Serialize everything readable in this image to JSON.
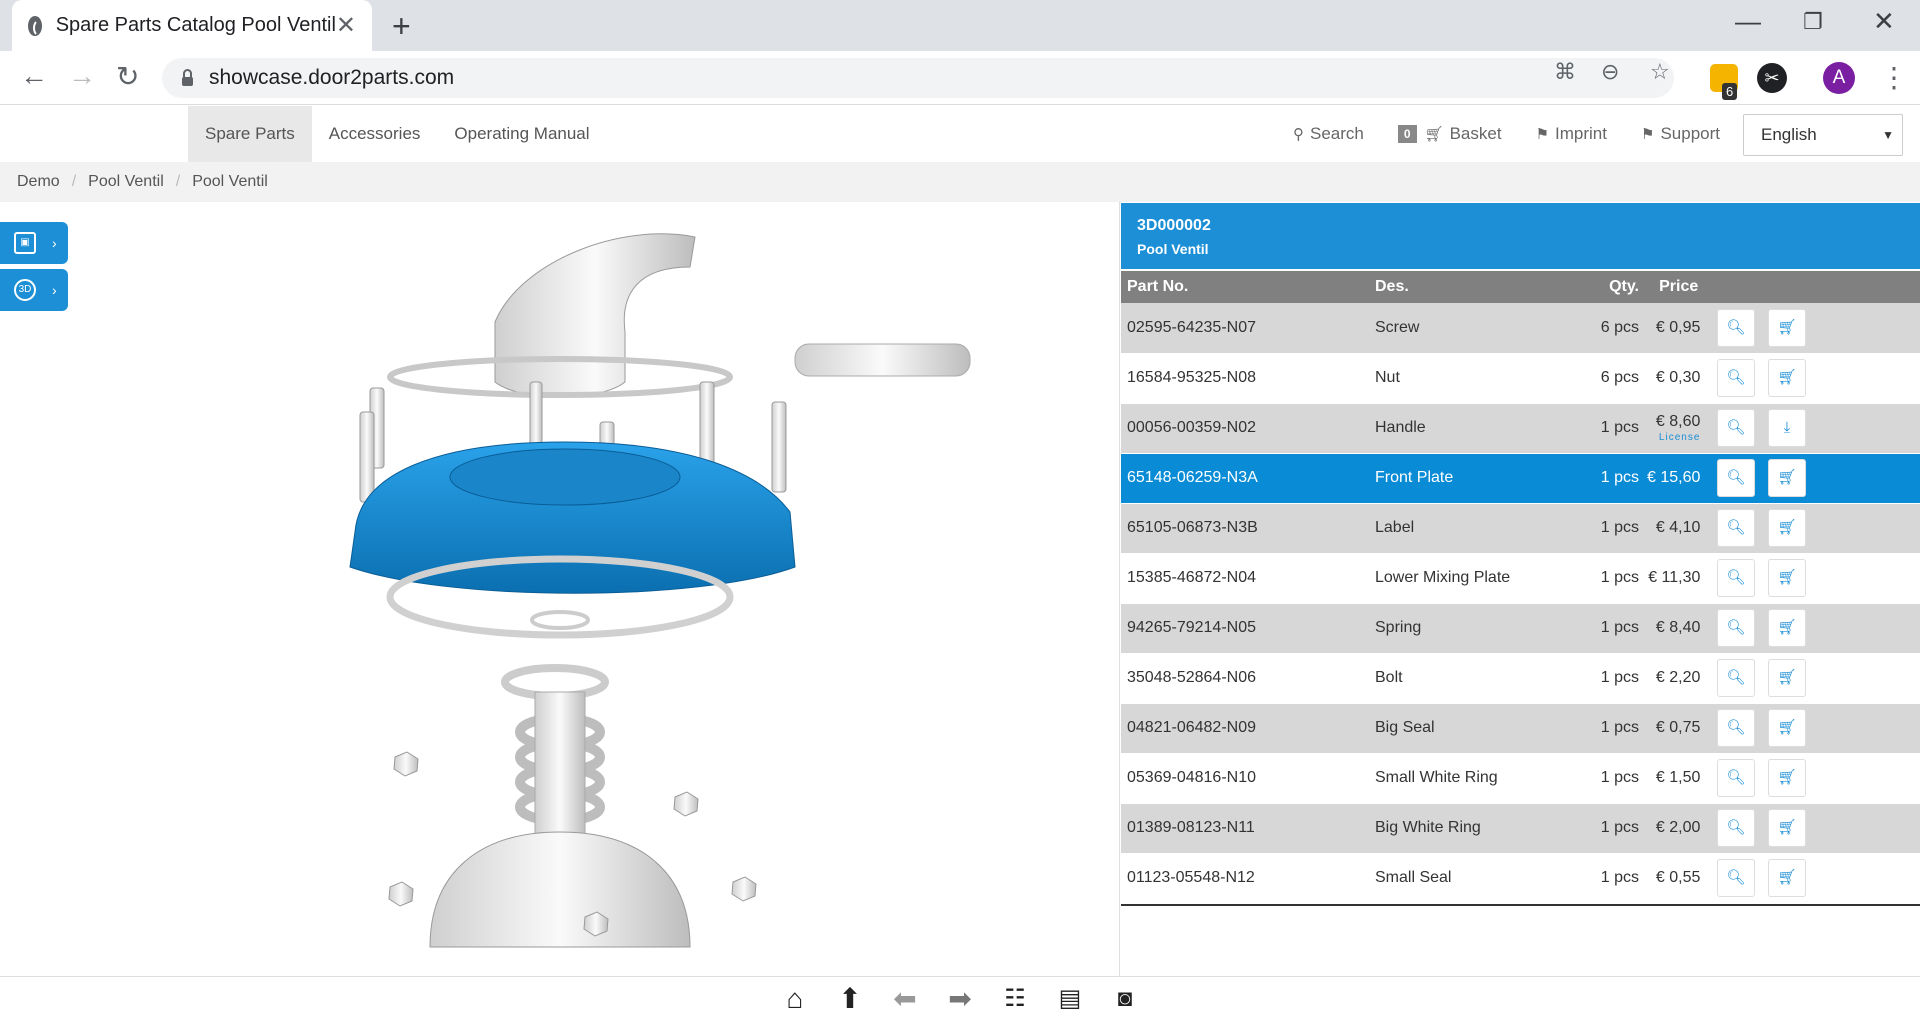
{
  "browser": {
    "tab_title": "Spare Parts Catalog Pool Ventil",
    "url": "showcase.door2parts.com",
    "ext_badge": "6",
    "avatar_letter": "A"
  },
  "nav": {
    "items": [
      "Spare Parts",
      "Accessories",
      "Operating Manual"
    ],
    "search": "Search",
    "basket_count": "0",
    "basket": "Basket",
    "imprint": "Imprint",
    "support": "Support",
    "language": "English"
  },
  "breadcrumb": [
    "Demo",
    "Pool Ventil",
    "Pool Ventil"
  ],
  "viewer": {
    "btn_3d": "3D"
  },
  "assembly": {
    "number": "3D000002",
    "name": "Pool Ventil"
  },
  "table": {
    "headers": {
      "part_no": "Part No.",
      "des": "Des.",
      "qty": "Qty.",
      "price": "Price"
    },
    "license_label": "License",
    "rows": [
      {
        "part_no": "02595-64235-N07",
        "des": "Screw",
        "qty": "6 pcs",
        "price": "€ 0,95",
        "action": "cart"
      },
      {
        "part_no": "16584-95325-N08",
        "des": "Nut",
        "qty": "6 pcs",
        "price": "€ 0,30",
        "action": "cart"
      },
      {
        "part_no": "00056-00359-N02",
        "des": "Handle",
        "qty": "1 pcs",
        "price": "€ 8,60",
        "action": "download",
        "license": true
      },
      {
        "part_no": "65148-06259-N3A",
        "des": "Front Plate",
        "qty": "1 pcs",
        "price": "€ 15,60",
        "action": "cart",
        "selected": true
      },
      {
        "part_no": "65105-06873-N3B",
        "des": "Label",
        "qty": "1 pcs",
        "price": "€ 4,10",
        "action": "cart"
      },
      {
        "part_no": "15385-46872-N04",
        "des": "Lower Mixing Plate",
        "qty": "1 pcs",
        "price": "€ 11,30",
        "action": "cart"
      },
      {
        "part_no": "94265-79214-N05",
        "des": "Spring",
        "qty": "1 pcs",
        "price": "€ 8,40",
        "action": "cart"
      },
      {
        "part_no": "35048-52864-N06",
        "des": "Bolt",
        "qty": "1 pcs",
        "price": "€ 2,20",
        "action": "cart"
      },
      {
        "part_no": "04821-06482-N09",
        "des": "Big Seal",
        "qty": "1 pcs",
        "price": "€ 0,75",
        "action": "cart"
      },
      {
        "part_no": "05369-04816-N10",
        "des": "Small White Ring",
        "qty": "1 pcs",
        "price": "€ 1,50",
        "action": "cart"
      },
      {
        "part_no": "01389-08123-N11",
        "des": "Big White Ring",
        "qty": "1 pcs",
        "price": "€ 2,00",
        "action": "cart"
      },
      {
        "part_no": "01123-05548-N12",
        "des": "Small Seal",
        "qty": "1 pcs",
        "price": "€ 0,55",
        "action": "cart"
      }
    ]
  },
  "toolbar": [
    "home-icon",
    "up-arrow-icon",
    "back-arrow-icon",
    "forward-arrow-icon",
    "tree-icon",
    "list-image-icon",
    "vr-goggles-icon"
  ],
  "colors": {
    "accent": "#1c8fd6",
    "selected_row": "#0a8bd6",
    "header_grey": "#808080"
  }
}
